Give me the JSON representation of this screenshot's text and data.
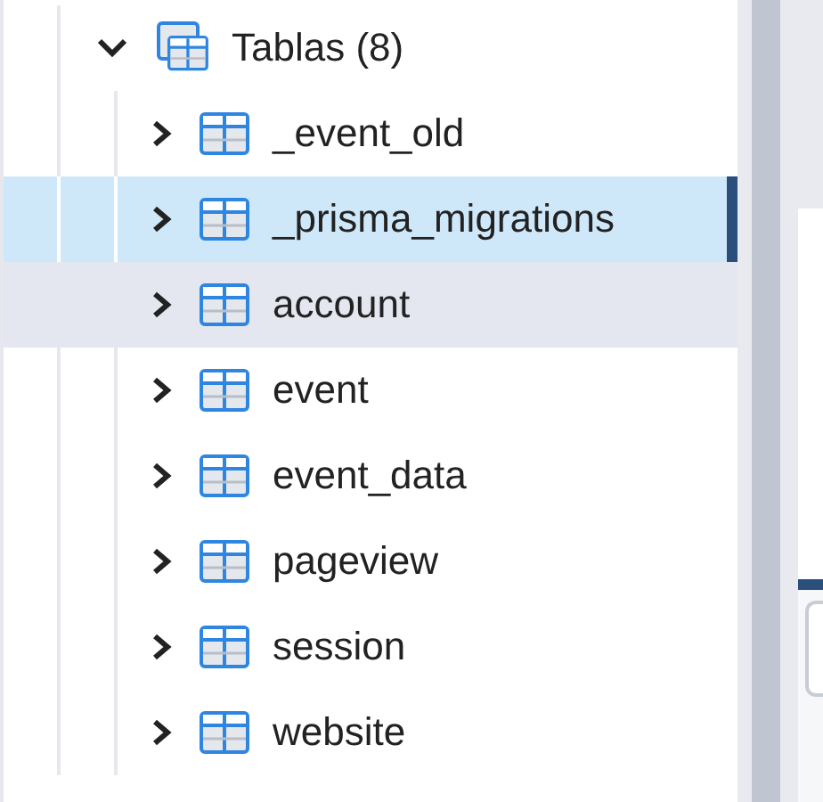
{
  "tree": {
    "label": "Tablas (8)",
    "expanded": true,
    "children": [
      {
        "label": "_event_old",
        "selected": false,
        "hovered": false
      },
      {
        "label": "_prisma_migrations",
        "selected": true,
        "hovered": false
      },
      {
        "label": "account",
        "selected": false,
        "hovered": true
      },
      {
        "label": "event",
        "selected": false,
        "hovered": false
      },
      {
        "label": "event_data",
        "selected": false,
        "hovered": false
      },
      {
        "label": "pageview",
        "selected": false,
        "hovered": false
      },
      {
        "label": "session",
        "selected": false,
        "hovered": false
      },
      {
        "label": "website",
        "selected": false,
        "hovered": false
      }
    ]
  }
}
